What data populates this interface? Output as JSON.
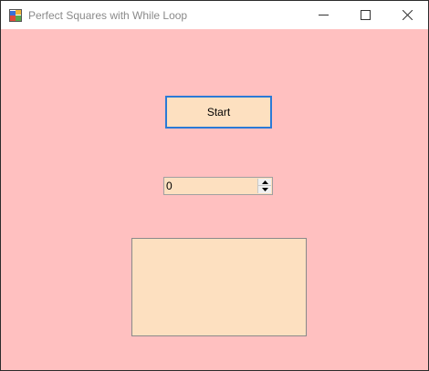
{
  "window": {
    "title": "Perfect Squares with While Loop",
    "icon": "winforms-app-icon",
    "controls": {
      "minimize": "minimize-icon",
      "maximize": "maximize-icon",
      "close": "close-icon"
    }
  },
  "form": {
    "start_label": "Start",
    "number_value": "0",
    "output_text": ""
  },
  "colors": {
    "form_background": "#ffc0c0",
    "control_background": "#fde0c0",
    "focus_border": "#2a7ad6"
  }
}
